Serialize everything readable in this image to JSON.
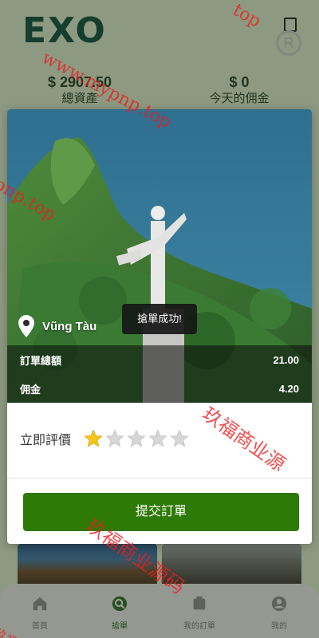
{
  "brand": {
    "logo_text": "EXO"
  },
  "stats": {
    "total_assets_amount": "$ 2907.50",
    "total_assets_label": "總資產",
    "today_commission_amount": "$ 0",
    "today_commission_label": "今天的佣金"
  },
  "modal": {
    "location_name": "Vũng Tàu",
    "toast_message": "搶單成功!",
    "order_total_label": "訂單總額",
    "order_total_value": "21.00",
    "commission_label": "佣金",
    "commission_value": "4.20",
    "rating_label": "立即評價",
    "rating_value": "1 of 5",
    "submit_label": "提交訂單"
  },
  "nav": {
    "items": [
      {
        "label": "首頁",
        "icon": "home-icon"
      },
      {
        "label": "搶單",
        "icon": "grab-order-icon"
      },
      {
        "label": "我的訂單",
        "icon": "orders-icon"
      },
      {
        "label": "我的",
        "icon": "user-icon"
      }
    ],
    "active_index": 1
  },
  "watermarks": [
    "www.mypnp.top",
    "玖福商业源",
    "玖福商业源码",
    "pnp.top",
    "top",
    "玖福"
  ],
  "colors": {
    "accent": "#2e7a07",
    "brand_dark": "#0c4a3c",
    "brand_light": "#7fc24a",
    "star_active": "#f5c518",
    "star_inactive": "#d6d6d6"
  }
}
